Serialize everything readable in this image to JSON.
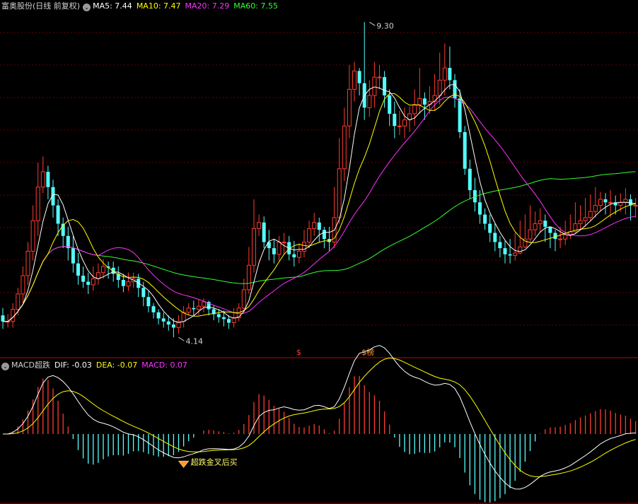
{
  "colors": {
    "up": "#ff3b30",
    "down": "#54ffff",
    "ma5": "#ffffff",
    "ma10": "#ffff00",
    "ma20": "#ff33ff",
    "ma60": "#33ff33",
    "dif": "#ffffff",
    "dea": "#ffff00",
    "macd": "#ff33ff",
    "separator": "#a00000",
    "grid": "#6a0000",
    "signal": "#ff3b30",
    "signal2": "#ff9933",
    "note": "#ffff66"
  },
  "main_legend": {
    "title": "富奥股份(日线 前复权)",
    "icon": "chevron-down-icon",
    "ma5": "MA5: 7.44",
    "ma10": "MA10: 7.47",
    "ma20": "MA20: 7.29",
    "ma60": "MA60: 7.55"
  },
  "sub_legend": {
    "title": "MACD超跌",
    "icon": "chevron-down-icon",
    "dif": "DIF: -0.03",
    "dea": "DEA: -0.07",
    "macd": "MACD: 0.07"
  },
  "chart_data": [
    {
      "type": "candlestick",
      "title": "富奥股份(日线 前复权)",
      "ylim": [
        3.9,
        9.5
      ],
      "grid": true,
      "annotations": [
        {
          "text": "9.30",
          "kind": "high",
          "x": 73,
          "y": 9.3
        },
        {
          "text": "4.14",
          "kind": "low",
          "x": 35,
          "y": 4.14
        }
      ],
      "signals": [
        {
          "text": "$",
          "x": 59
        },
        {
          "text": "$榜",
          "x": 72
        }
      ],
      "moving_averages": [
        "MA5",
        "MA10",
        "MA20",
        "MA60"
      ],
      "candles": {
        "x": [
          0,
          1,
          2,
          3,
          4,
          5,
          6,
          7,
          8,
          9,
          10,
          11,
          12,
          13,
          14,
          15,
          16,
          17,
          18,
          19,
          20,
          21,
          22,
          23,
          24,
          25,
          26,
          27,
          28,
          29,
          30,
          31,
          32,
          33,
          34,
          35,
          36,
          37,
          38,
          39,
          40,
          41,
          42,
          43,
          44,
          45,
          46,
          47,
          48,
          49,
          50,
          51,
          52,
          53,
          54,
          55,
          56,
          57,
          58,
          59,
          60,
          61,
          62,
          63,
          64,
          65,
          66,
          67,
          68,
          69,
          70,
          71,
          72,
          73,
          74,
          75,
          76,
          77,
          78,
          79,
          80,
          81,
          82,
          83,
          84,
          85,
          86,
          87,
          88,
          89,
          90,
          91,
          92,
          93,
          94,
          95,
          96,
          97,
          98,
          99,
          100,
          101,
          102,
          103,
          104,
          105,
          106,
          107,
          108,
          109,
          110,
          111,
          112,
          113,
          114,
          115,
          116,
          117,
          118,
          119,
          120,
          121,
          122,
          123,
          124,
          125,
          126
        ],
        "open": [
          4.5,
          4.4,
          4.4,
          4.6,
          4.85,
          5.15,
          5.55,
          6.05,
          6.6,
          6.85,
          6.6,
          6.3,
          6.0,
          5.8,
          5.6,
          5.35,
          5.15,
          5.05,
          5.0,
          5.1,
          5.2,
          5.3,
          5.28,
          5.18,
          5.08,
          4.98,
          5.05,
          5.1,
          4.95,
          4.8,
          4.65,
          4.55,
          4.45,
          4.4,
          4.35,
          4.3,
          4.4,
          4.55,
          4.62,
          4.6,
          4.65,
          4.72,
          4.6,
          4.52,
          4.47,
          4.44,
          4.38,
          4.46,
          4.62,
          4.92,
          5.32,
          5.92,
          6.02,
          5.7,
          5.6,
          5.5,
          5.7,
          5.7,
          5.5,
          5.45,
          5.55,
          5.7,
          5.92,
          6.02,
          5.9,
          5.75,
          5.7,
          6.1,
          6.9,
          7.6,
          8.2,
          8.5,
          8.3,
          7.9,
          8.1,
          8.4,
          8.4,
          8.1,
          7.8,
          7.6,
          7.6,
          7.7,
          7.8,
          7.95,
          8.05,
          7.95,
          8.0,
          8.1,
          8.35,
          8.55,
          8.35,
          8.05,
          7.5,
          6.9,
          6.55,
          6.35,
          6.15,
          6.0,
          5.85,
          5.7,
          5.6,
          5.5,
          5.48,
          5.52,
          5.62,
          5.75,
          5.9,
          6.0,
          6.05,
          5.95,
          5.85,
          5.75,
          5.75,
          5.82,
          5.87,
          6.0,
          6.05,
          6.1,
          6.2,
          6.3,
          6.4,
          6.35,
          6.35,
          6.3,
          6.35,
          6.4,
          6.3
        ],
        "close": [
          4.4,
          4.4,
          4.6,
          4.85,
          5.15,
          5.55,
          6.05,
          6.6,
          6.85,
          6.6,
          6.3,
          6.0,
          5.8,
          5.6,
          5.35,
          5.15,
          5.05,
          5.0,
          5.1,
          5.2,
          5.3,
          5.28,
          5.18,
          5.08,
          4.98,
          5.05,
          5.1,
          4.95,
          4.8,
          4.65,
          4.55,
          4.45,
          4.4,
          4.35,
          4.3,
          4.4,
          4.55,
          4.62,
          4.6,
          4.65,
          4.72,
          4.6,
          4.52,
          4.47,
          4.44,
          4.38,
          4.46,
          4.62,
          4.92,
          5.32,
          5.92,
          6.02,
          5.7,
          5.6,
          5.5,
          5.7,
          5.7,
          5.5,
          5.45,
          5.55,
          5.7,
          5.92,
          6.02,
          5.9,
          5.75,
          5.7,
          6.1,
          6.9,
          7.6,
          8.2,
          8.5,
          8.3,
          7.9,
          8.1,
          8.4,
          8.4,
          8.1,
          7.8,
          7.6,
          7.6,
          7.7,
          7.8,
          7.95,
          8.05,
          7.95,
          8.0,
          8.1,
          8.35,
          8.55,
          8.35,
          8.05,
          7.5,
          6.9,
          6.55,
          6.35,
          6.15,
          6.0,
          5.85,
          5.7,
          5.6,
          5.5,
          5.48,
          5.52,
          5.62,
          5.75,
          5.9,
          6.0,
          6.05,
          5.95,
          5.85,
          5.75,
          5.75,
          5.82,
          5.87,
          6.0,
          6.05,
          6.1,
          6.2,
          6.3,
          6.4,
          6.35,
          6.35,
          6.3,
          6.35,
          6.4,
          6.3,
          6.3
        ],
        "high": [
          4.62,
          4.52,
          4.7,
          4.95,
          5.3,
          5.7,
          6.3,
          7.0,
          7.1,
          6.95,
          6.72,
          6.4,
          6.1,
          5.95,
          5.8,
          5.52,
          5.3,
          5.2,
          5.3,
          5.35,
          5.42,
          5.38,
          5.38,
          5.3,
          5.18,
          5.2,
          5.2,
          5.18,
          5.05,
          4.9,
          4.7,
          4.6,
          4.55,
          4.5,
          4.45,
          4.5,
          4.65,
          4.7,
          4.74,
          4.76,
          4.78,
          4.74,
          4.66,
          4.6,
          4.58,
          4.5,
          4.62,
          4.7,
          5.1,
          5.62,
          6.4,
          6.15,
          6.12,
          5.9,
          5.75,
          5.8,
          5.85,
          5.8,
          5.72,
          5.68,
          5.9,
          6.05,
          6.18,
          6.1,
          5.95,
          5.95,
          6.6,
          7.4,
          7.9,
          8.6,
          8.65,
          8.55,
          9.3,
          8.35,
          8.65,
          8.6,
          8.5,
          8.2,
          8.0,
          7.85,
          7.9,
          7.92,
          8.2,
          8.55,
          8.15,
          8.25,
          8.45,
          8.8,
          8.95,
          8.9,
          8.45,
          8.2,
          7.6,
          7.05,
          6.75,
          6.55,
          6.25,
          6.15,
          6.0,
          5.8,
          5.72,
          5.75,
          5.85,
          6.05,
          6.15,
          6.3,
          6.2,
          6.25,
          6.15,
          5.95,
          5.9,
          5.95,
          6.05,
          6.15,
          6.35,
          6.3,
          6.42,
          6.48,
          6.6,
          6.52,
          6.5,
          6.55,
          6.46,
          6.5,
          6.58,
          6.48,
          6.42
        ],
        "low": [
          4.28,
          4.3,
          4.3,
          4.5,
          4.7,
          5.0,
          5.4,
          5.8,
          6.5,
          6.4,
          6.1,
          5.8,
          5.6,
          5.4,
          5.2,
          5.0,
          4.95,
          4.85,
          4.9,
          5.0,
          5.1,
          5.1,
          5.05,
          4.95,
          4.88,
          4.9,
          4.95,
          4.8,
          4.65,
          4.55,
          4.45,
          4.35,
          4.3,
          4.25,
          4.14,
          4.2,
          4.3,
          4.5,
          4.5,
          4.5,
          4.55,
          4.5,
          4.42,
          4.38,
          4.32,
          4.28,
          4.3,
          4.4,
          4.55,
          4.85,
          5.2,
          5.8,
          5.6,
          5.4,
          5.35,
          5.4,
          5.5,
          5.4,
          5.3,
          5.35,
          5.45,
          5.6,
          5.8,
          5.7,
          5.6,
          5.55,
          5.6,
          6.0,
          6.7,
          7.4,
          8.0,
          8.1,
          7.7,
          7.75,
          7.9,
          8.2,
          7.9,
          7.6,
          7.4,
          7.45,
          7.4,
          7.5,
          7.6,
          7.8,
          7.7,
          7.8,
          7.85,
          7.95,
          8.1,
          8.2,
          7.9,
          7.4,
          6.8,
          6.4,
          6.2,
          6.0,
          5.9,
          5.7,
          5.55,
          5.45,
          5.35,
          5.35,
          5.4,
          5.5,
          5.6,
          5.7,
          5.8,
          5.85,
          5.7,
          5.6,
          5.55,
          5.6,
          5.65,
          5.75,
          5.85,
          5.9,
          5.95,
          6.05,
          6.1,
          6.2,
          6.15,
          6.1,
          6.15,
          6.2,
          6.15,
          6.05,
          6.1
        ]
      }
    },
    {
      "type": "macd",
      "title": "MACD超跌",
      "ylim": [
        -0.62,
        0.62
      ],
      "series_names": [
        "DIF",
        "DEA",
        "MACD"
      ],
      "annotations": [
        {
          "text": "超跌金叉后买",
          "x": 36
        }
      ]
    }
  ]
}
